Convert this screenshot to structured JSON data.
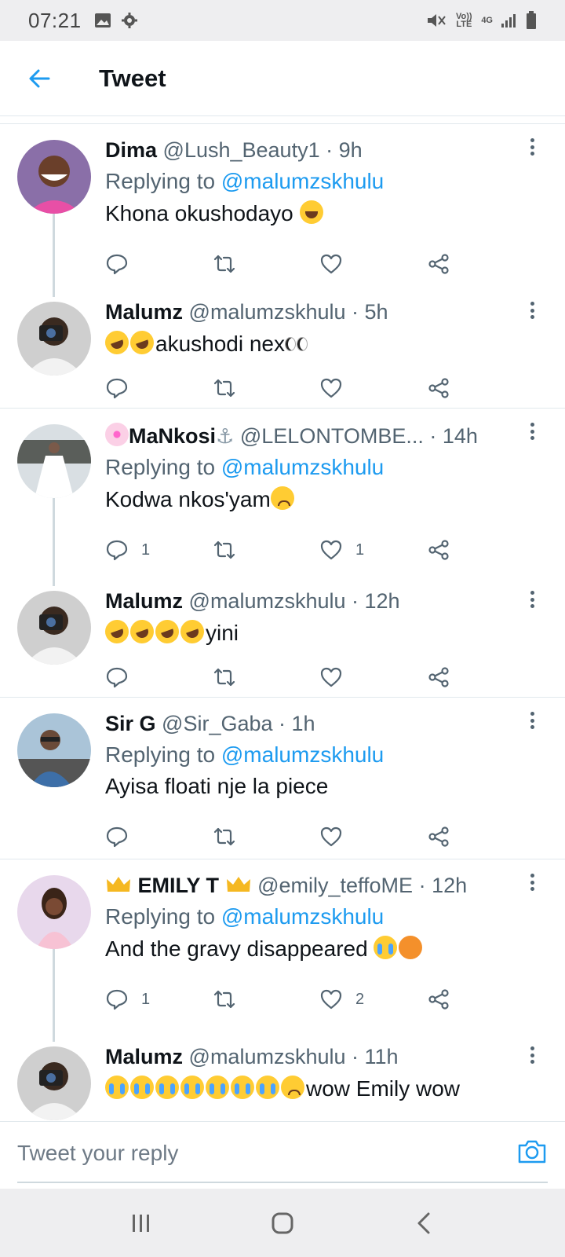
{
  "status_bar": {
    "time": "07:21",
    "network_label_1": "Vo)) LTE",
    "network_label_2": "4G"
  },
  "header": {
    "title": "Tweet"
  },
  "colors": {
    "accent": "#1d9bf0",
    "muted": "#536471",
    "text": "#0f1419",
    "divider": "#e1e8ed"
  },
  "tweets": [
    {
      "name": "Dima",
      "handle": "@Lush_Beauty1",
      "time": "· 9h",
      "replying_prefix": "Replying to",
      "replying_to": "@malumzskhulu",
      "text": "Khona okushodayo",
      "reply_count": "",
      "like_count": ""
    },
    {
      "name": "Malumz",
      "handle": "@malumzskhulu",
      "time": "· 5h",
      "text": "akushodi nex",
      "reply_count": "",
      "like_count": ""
    },
    {
      "name": "MaNkosi",
      "handle": "@LELONTOMBE...",
      "time": "· 14h",
      "replying_prefix": "Replying to",
      "replying_to": "@malumzskhulu",
      "text": "Kodwa nkos'yam",
      "reply_count": "1",
      "like_count": "1"
    },
    {
      "name": "Malumz",
      "handle": "@malumzskhulu",
      "time": "· 12h",
      "text": "yini",
      "reply_count": "",
      "like_count": ""
    },
    {
      "name": "Sir G",
      "handle": "@Sir_Gaba",
      "time": "· 1h",
      "replying_prefix": "Replying to",
      "replying_to": "@malumzskhulu",
      "text": "Ayisa floati nje la piece",
      "reply_count": "",
      "like_count": ""
    },
    {
      "name": "EMILY T",
      "handle": "@emily_teffoME",
      "time": "· 12h",
      "replying_prefix": "Replying to",
      "replying_to": "@malumzskhulu",
      "text": "And the gravy disappeared",
      "reply_count": "1",
      "like_count": "2"
    },
    {
      "name": "Malumz",
      "handle": "@malumzskhulu",
      "time": "· 11h",
      "text": "wow Emily wow"
    }
  ],
  "reply_bar": {
    "placeholder": "Tweet your reply"
  },
  "icons": {
    "back": "arrow-left-icon",
    "reply": "comment-icon",
    "retweet": "retweet-icon",
    "like": "heart-icon",
    "share": "share-icon",
    "more": "more-vertical-icon",
    "camera": "camera-icon"
  }
}
